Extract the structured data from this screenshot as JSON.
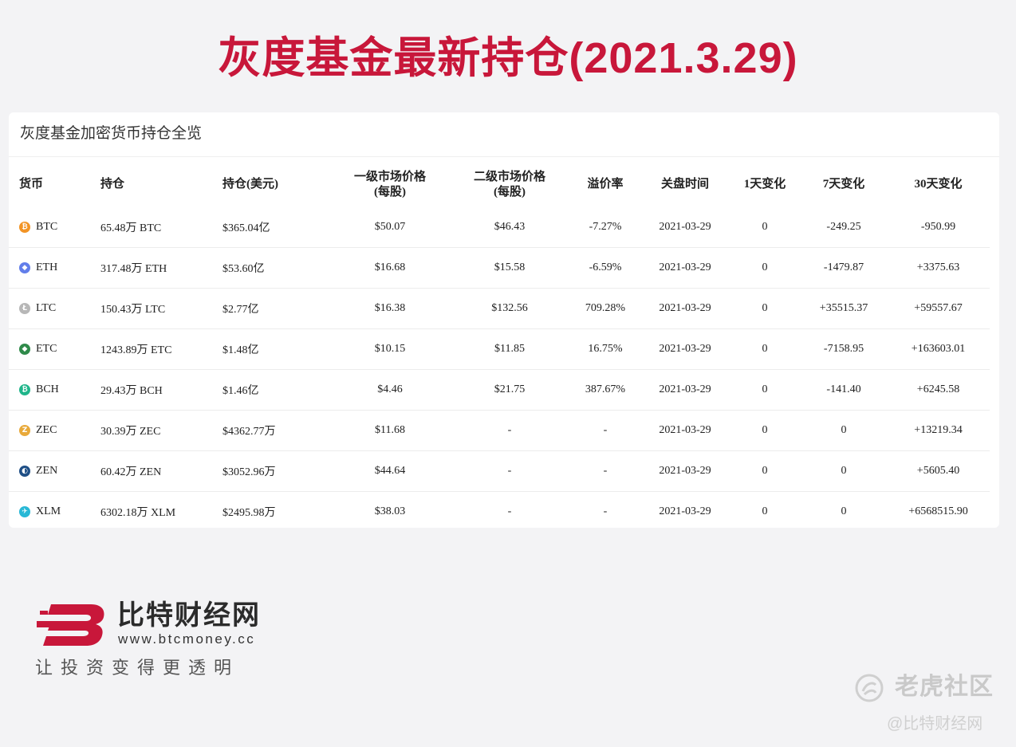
{
  "headline": "灰度基金最新持仓(2021.3.29)",
  "card": {
    "title": "灰度基金加密货币持仓全览",
    "headers": {
      "coin": "货币",
      "holdings": "持仓",
      "holdings_usd": "持仓(美元)",
      "primary_price": "一级市场价格",
      "primary_price_sub": "(每股)",
      "secondary_price": "二级市场价格",
      "secondary_price_sub": "(每股)",
      "premium": "溢价率",
      "close_time": "关盘时间",
      "change_1d": "1天变化",
      "change_7d": "7天变化",
      "change_30d": "30天变化"
    },
    "rows": [
      {
        "coin": "BTC",
        "holdings": "65.48万 BTC",
        "usd": "$365.04亿",
        "primary": "$50.07",
        "secondary": "$46.43",
        "premium": "-7.27%",
        "time": "2021-03-29",
        "d1": "0",
        "d7": "-249.25",
        "d30": "-950.99"
      },
      {
        "coin": "ETH",
        "holdings": "317.48万 ETH",
        "usd": "$53.60亿",
        "primary": "$16.68",
        "secondary": "$15.58",
        "premium": "-6.59%",
        "time": "2021-03-29",
        "d1": "0",
        "d7": "-1479.87",
        "d30": "+3375.63"
      },
      {
        "coin": "LTC",
        "holdings": "150.43万 LTC",
        "usd": "$2.77亿",
        "primary": "$16.38",
        "secondary": "$132.56",
        "premium": "709.28%",
        "time": "2021-03-29",
        "d1": "0",
        "d7": "+35515.37",
        "d30": "+59557.67"
      },
      {
        "coin": "ETC",
        "holdings": "1243.89万 ETC",
        "usd": "$1.48亿",
        "primary": "$10.15",
        "secondary": "$11.85",
        "premium": "16.75%",
        "time": "2021-03-29",
        "d1": "0",
        "d7": "-7158.95",
        "d30": "+163603.01"
      },
      {
        "coin": "BCH",
        "holdings": "29.43万 BCH",
        "usd": "$1.46亿",
        "primary": "$4.46",
        "secondary": "$21.75",
        "premium": "387.67%",
        "time": "2021-03-29",
        "d1": "0",
        "d7": "-141.40",
        "d30": "+6245.58"
      },
      {
        "coin": "ZEC",
        "holdings": "30.39万 ZEC",
        "usd": "$4362.77万",
        "primary": "$11.68",
        "secondary": "-",
        "premium": "-",
        "time": "2021-03-29",
        "d1": "0",
        "d7": "0",
        "d30": "+13219.34"
      },
      {
        "coin": "ZEN",
        "holdings": "60.42万 ZEN",
        "usd": "$3052.96万",
        "primary": "$44.64",
        "secondary": "-",
        "premium": "-",
        "time": "2021-03-29",
        "d1": "0",
        "d7": "0",
        "d30": "+5605.40"
      },
      {
        "coin": "XLM",
        "holdings": "6302.18万 XLM",
        "usd": "$2495.98万",
        "primary": "$38.03",
        "secondary": "-",
        "premium": "-",
        "time": "2021-03-29",
        "d1": "0",
        "d7": "0",
        "d30": "+6568515.90"
      }
    ],
    "icon_colors": {
      "BTC": "#f29425",
      "ETH": "#627eea",
      "LTC": "#b7b7b7",
      "ETC": "#2f8a4a",
      "BCH": "#1fb58a",
      "ZEC": "#e8a93a",
      "ZEN": "#1f4f86",
      "XLM": "#28b8d6"
    },
    "icon_glyphs": {
      "BTC": "₿",
      "ETH": "◆",
      "LTC": "Ł",
      "ETC": "◆",
      "BCH": "₿",
      "ZEC": "Z",
      "ZEN": "◐",
      "XLM": "✈"
    }
  },
  "brand": {
    "name": "比特财经网",
    "url": "www.btcmoney.cc",
    "slogan": "让投资变得更透明",
    "accent": "#c8173a"
  },
  "watermark": {
    "community": "老虎社区",
    "handle": "@比特财经网"
  }
}
